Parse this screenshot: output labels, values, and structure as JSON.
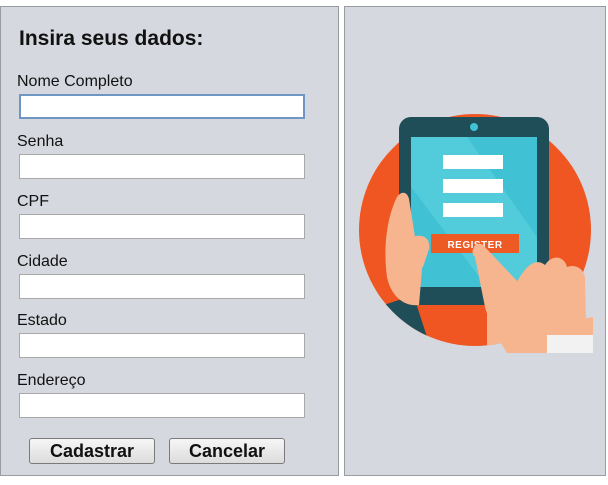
{
  "form": {
    "title": "Insira seus dados:",
    "fields": [
      {
        "label": "Nome Completo",
        "value": "",
        "placeholder": ""
      },
      {
        "label": "Senha",
        "value": "",
        "placeholder": ""
      },
      {
        "label": "CPF",
        "value": "",
        "placeholder": ""
      },
      {
        "label": "Cidade",
        "value": "",
        "placeholder": ""
      },
      {
        "label": "Estado",
        "value": "",
        "placeholder": ""
      },
      {
        "label": "Endereço",
        "value": "",
        "placeholder": ""
      }
    ],
    "buttons": {
      "submit_label": "Cadastrar",
      "cancel_label": "Cancelar"
    }
  },
  "illustration": {
    "button_text": "REGISTER",
    "colors": {
      "circle": "#ef5622",
      "tablet_frame": "#1f4e58",
      "screen": "#40c2d4",
      "register_button": "#ee5a24",
      "skin": "#f6b58f",
      "panel_bg": "#d6d8df"
    }
  }
}
